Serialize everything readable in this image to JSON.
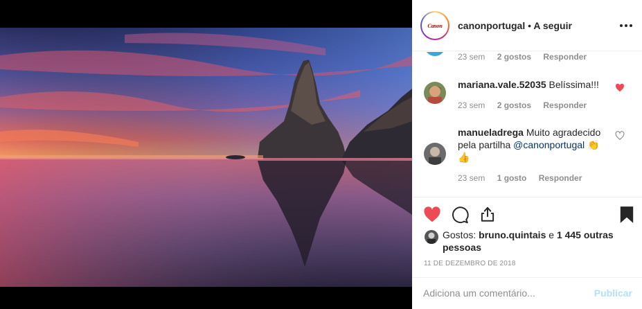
{
  "header": {
    "avatar_text": "Canon",
    "username": "canonportugal",
    "separator": "•",
    "follow_label": "A seguir",
    "more_icon": "more-horizontal-icon"
  },
  "comments": [
    {
      "username": "",
      "text": "",
      "time": "23 sem",
      "likes": "2 gostos",
      "reply": "Responder",
      "liked": false
    },
    {
      "username": "mariana.vale.52035",
      "text": "Belíssima!!!",
      "time": "23 sem",
      "likes": "2 gostos",
      "reply": "Responder",
      "liked": true
    },
    {
      "username": "manueladrega",
      "text": "Muito agradecido pela partilha",
      "mention": "@canonportugal",
      "emoji": "👏👍",
      "time": "23 sem",
      "likes": "1 gosto",
      "reply": "Responder",
      "liked": false
    }
  ],
  "actions": {
    "like_icon": "heart-filled-icon",
    "comment_icon": "speech-bubble-icon",
    "share_icon": "share-icon",
    "save_icon": "bookmark-filled-icon"
  },
  "likes": {
    "prefix": "Gostos:",
    "user": "bruno.quintais",
    "connector": "e",
    "others": "1 445 outras pessoas"
  },
  "post_date": "11 DE DEZEMBRO DE 2018",
  "comment_bar": {
    "placeholder": "Adiciona um comentário...",
    "publish_label": "Publicar"
  },
  "colors": {
    "like_red": "#ed4956",
    "link_blue": "#003569",
    "publish_disabled": "#b2dffc",
    "meta_gray": "#8e8e8e"
  }
}
